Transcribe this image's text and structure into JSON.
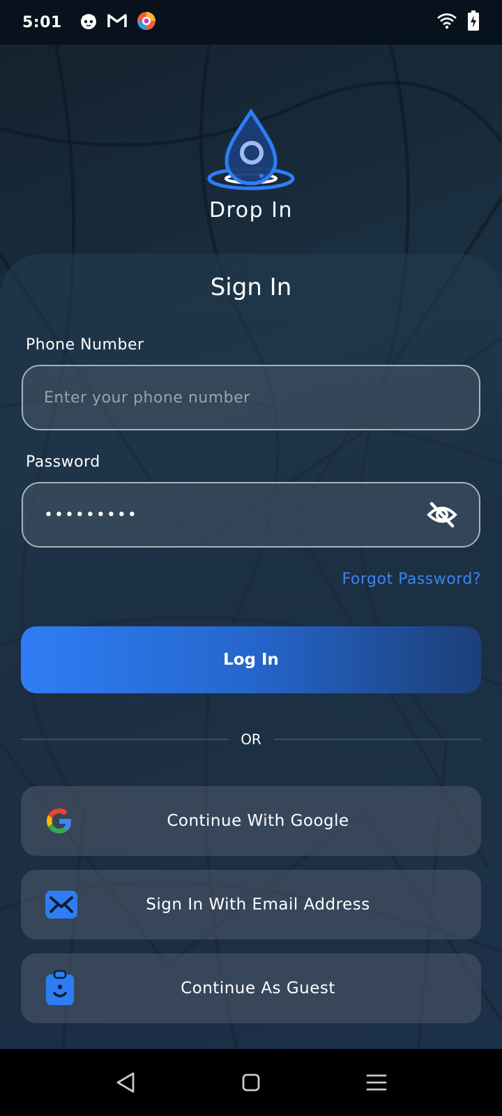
{
  "status_bar": {
    "time": "5:01",
    "notification_icons": [
      "cat-icon",
      "gmail-icon",
      "browser-icon"
    ],
    "system_icons": [
      "wifi-icon",
      "battery-charging-icon"
    ]
  },
  "brand": {
    "name": "Drop In",
    "logo_icon": "water-drop-logo-icon"
  },
  "form": {
    "title": "Sign In",
    "phone": {
      "label": "Phone Number",
      "placeholder": "Enter your phone number",
      "value": ""
    },
    "password": {
      "label": "Password",
      "value": "•••••••••",
      "toggle_icon": "eye-off-icon"
    },
    "forgot_password": "Forgot Password?",
    "login_button": "Log In",
    "divider_text": "OR"
  },
  "alternatives": [
    {
      "label": "Continue With Google",
      "icon": "google-icon"
    },
    {
      "label": "Sign In With Email Address",
      "icon": "email-icon"
    },
    {
      "label": "Continue As Guest",
      "icon": "guest-badge-icon"
    }
  ],
  "nav_bar": {
    "buttons": [
      "back-icon",
      "home-icon",
      "menu-icon"
    ]
  },
  "colors": {
    "accent": "#3a86f0",
    "button_start": "#2f7df5",
    "button_end": "#1c3f78"
  }
}
